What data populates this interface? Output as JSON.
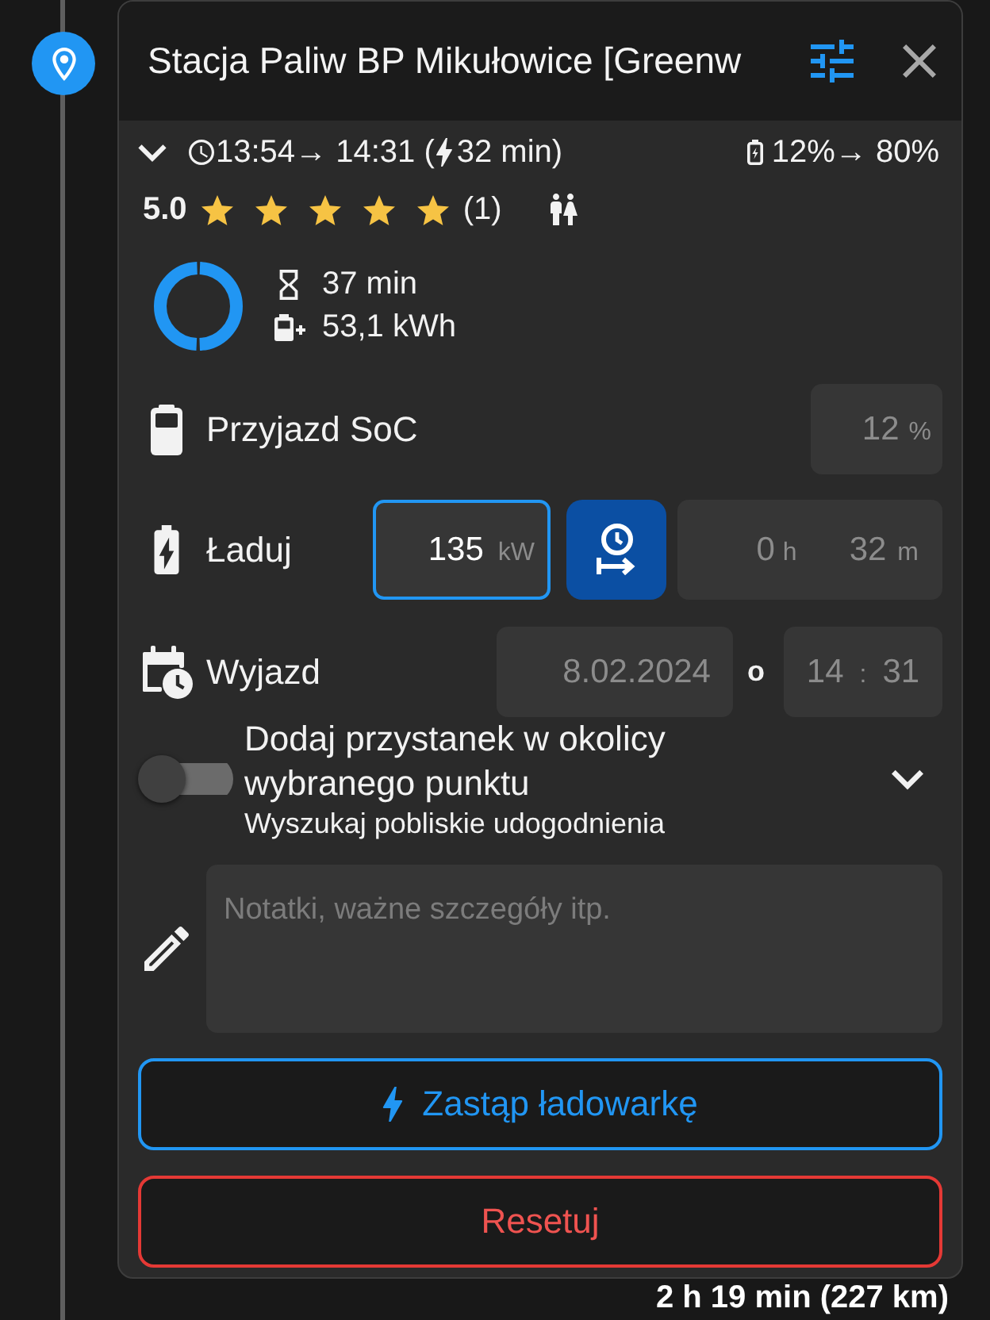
{
  "header": {
    "title": "Stacja Paliw BP Mikułowice [Greenw"
  },
  "summary": {
    "time_range": "13:54→ 14:31 (",
    "charge_time": "32 min)",
    "soc_range": "12%→ 80%"
  },
  "rating": {
    "score": "5.0",
    "stars": 5,
    "count": "(1)"
  },
  "charge_estimate": {
    "duration": "37 min",
    "energy": "53,1 kWh"
  },
  "arrival_soc": {
    "label": "Przyjazd SoC",
    "value": "12",
    "unit": "%"
  },
  "charge": {
    "label": "Ładuj",
    "power": {
      "value": "135",
      "unit": "kW",
      "focused": true
    },
    "duration": {
      "hours": "0",
      "hours_unit": "h",
      "minutes": "32",
      "minutes_unit": "m"
    }
  },
  "departure": {
    "label": "Wyjazd",
    "date": "8.02.2024",
    "connector": "o",
    "hour": "14",
    "separator": ":",
    "minute": "31"
  },
  "nearby_stop": {
    "title": "Dodaj przystanek w okolicy wybranego punktu",
    "subtitle": "Wyszukaj pobliskie udogodnienia",
    "on": false
  },
  "notes": {
    "placeholder": "Notatki, ważne szczegóły itp."
  },
  "buttons": [
    {
      "kind": "primary",
      "label": "Zastąp ładowarkę"
    },
    {
      "kind": "danger",
      "label": "Resetuj"
    }
  ],
  "leg_summary": "2 h 19 min (227 km)"
}
